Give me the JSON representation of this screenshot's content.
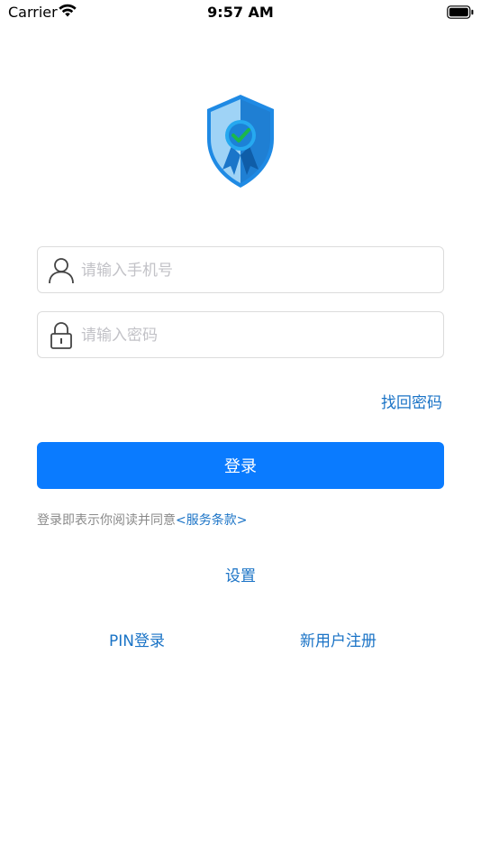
{
  "status_bar": {
    "carrier": "Carrier",
    "time": "9:57 AM",
    "icons": [
      "wifi-icon",
      "battery-icon"
    ]
  },
  "logo": {
    "icon": "shield-badge-icon",
    "colors": {
      "light": "#9fd3f6",
      "dark": "#1f7fd3",
      "check": "#1bb84a"
    }
  },
  "form": {
    "phone_placeholder": "请输入手机号",
    "password_placeholder": "请输入密码",
    "forgot_label": "找回密码",
    "login_label": "登录"
  },
  "agreement": {
    "text": "登录即表示你阅读并同意",
    "terms_link": "<服务条款>"
  },
  "links": {
    "settings": "设置",
    "pin_login": "PIN登录",
    "register": "新用户注册"
  },
  "colors": {
    "accent": "#0a7bff",
    "link": "#1a73c6"
  }
}
